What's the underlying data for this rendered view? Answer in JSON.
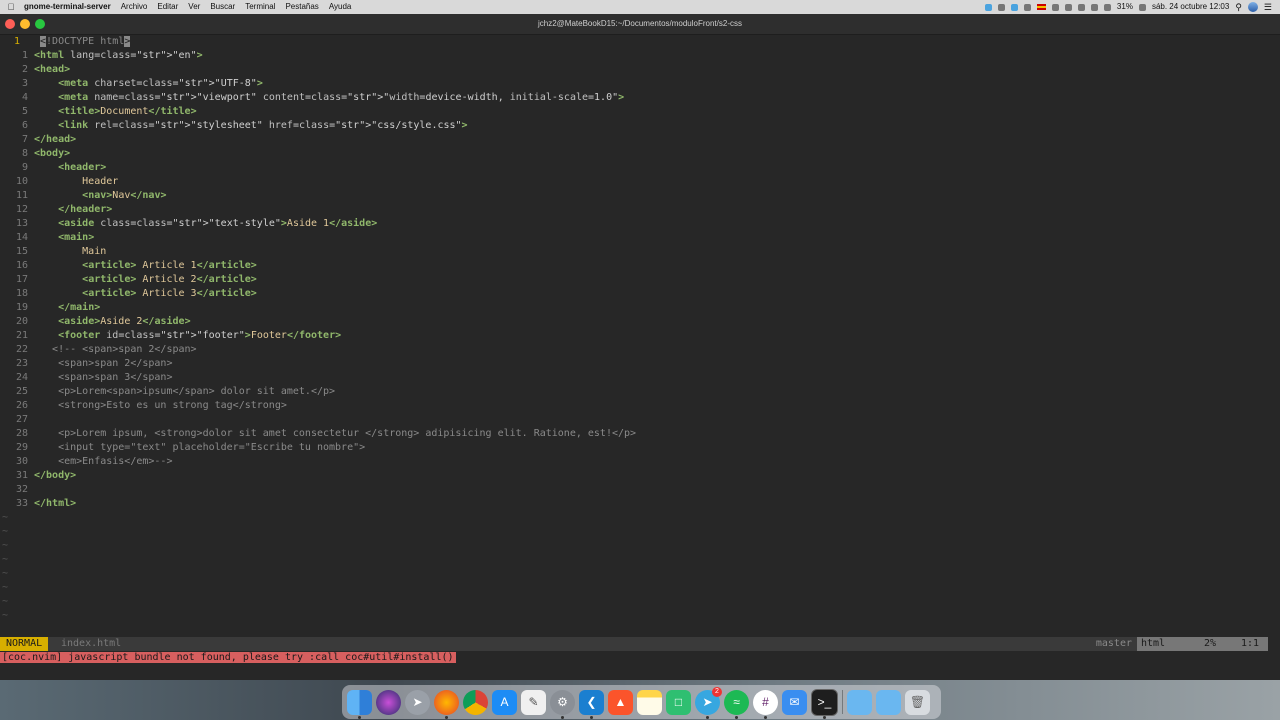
{
  "menubar": {
    "app_name": "gnome-terminal-server",
    "items": [
      "Archivo",
      "Editar",
      "Ver",
      "Buscar",
      "Terminal",
      "Pestañas",
      "Ayuda"
    ],
    "battery": "31%",
    "datetime": "sáb. 24 octubre 12:03"
  },
  "window": {
    "title": "jchz2@MateBookD15:~/Documentos/moduloFront/s2-css"
  },
  "editor": {
    "lines": [
      "<!DOCTYPE html>",
      "<html lang=\"en\">",
      "<head>",
      "    <meta charset=\"UTF-8\">",
      "    <meta name=\"viewport\" content=\"width=device-width, initial-scale=1.0\">",
      "    <title>Document</title>",
      "    <link rel=\"stylesheet\" href=\"css/style.css\">",
      "</head>",
      "<body>",
      "    <header>",
      "        Header",
      "        <nav>Nav</nav>",
      "    </header>",
      "    <aside class=\"text-style\">Aside 1</aside>",
      "    <main>",
      "        Main",
      "        <article> Article 1</article>",
      "        <article> Article 2</article>",
      "        <article> Article 3</article>",
      "    </main>",
      "    <aside>Aside 2</aside>",
      "    <footer id=\"footer\">Footer</footer>",
      "   <!-- <span>span 2</span>",
      "    <span>span 2</span>",
      "    <span>span 3</span>",
      "    <p>Lorem<span>ipsum</span> dolor sit amet.</p>",
      "    <strong>Esto es un strong tag</strong>",
      "",
      "    <p>Lorem ipsum, <strong>dolor sit amet consectetur </strong> adipisicing elit. Ratione, est!</p>",
      "    <input type=\"text\" placeholder=\"Escribe tu nombre\">",
      "    <em>Enfasis</em>-->",
      "</body>",
      "",
      "</html>"
    ],
    "line_numbers": [
      "1",
      "1",
      "2",
      "3",
      "4",
      "5",
      "6",
      "7",
      "8",
      "9",
      "10",
      "11",
      "12",
      "13",
      "14",
      "15",
      "16",
      "17",
      "18",
      "19",
      "20",
      "21",
      "22",
      "23",
      "24",
      "25",
      "26",
      "27",
      "28",
      "29",
      "30",
      "31",
      "32",
      "33"
    ],
    "tilde": "~"
  },
  "statusline": {
    "mode": "NORMAL",
    "filename": "index.html",
    "branch": "master",
    "filetype": "html",
    "percent": "2%",
    "position": "1:1"
  },
  "cmdline": {
    "message": "[coc.nvim] javascript bundle not found, please try :call coc#util#install()"
  },
  "dock": {
    "apps": [
      "finder-icon",
      "siri-icon",
      "launchpad-icon",
      "firefox-icon",
      "chrome-icon",
      "app-store-icon",
      "textedit-icon",
      "system-preferences-icon",
      "vscode-icon",
      "brave-icon",
      "notes-icon",
      "numbers-icon",
      "telegram-icon",
      "spotify-icon",
      "slack-icon",
      "mail-icon",
      "terminal-icon",
      "folder-icon",
      "downloads-folder-icon",
      "trash-icon"
    ],
    "telegram_badge": "2"
  }
}
